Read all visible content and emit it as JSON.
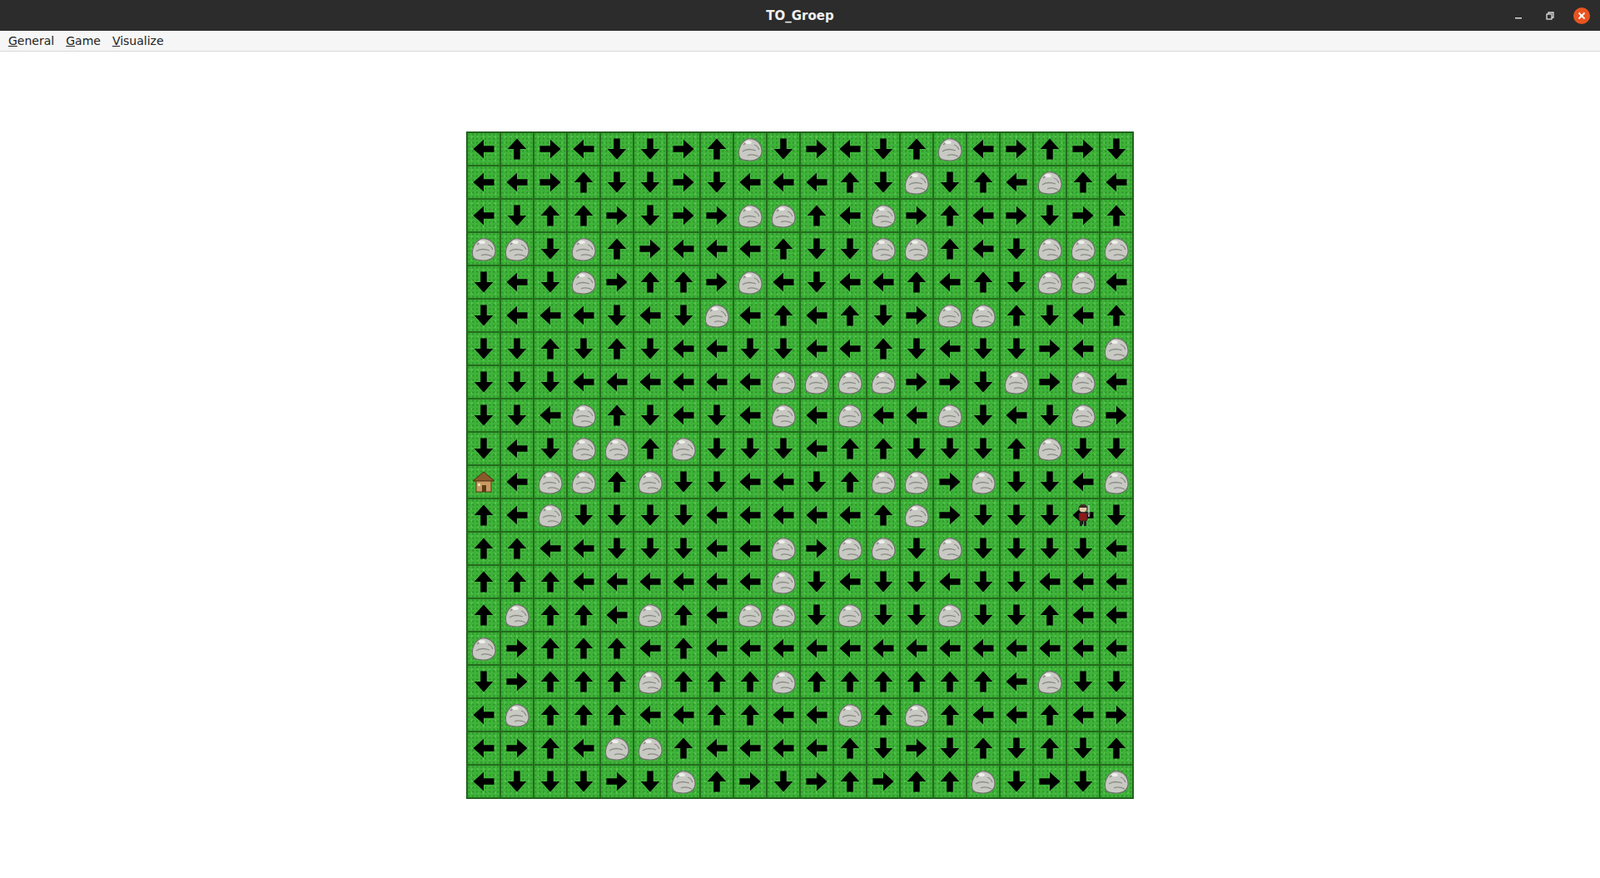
{
  "window": {
    "title": "TO_Groep"
  },
  "menu": [
    {
      "label": "General"
    },
    {
      "label": "Game"
    },
    {
      "label": "Visualize"
    }
  ],
  "player": {
    "row": 11,
    "col": 18
  },
  "grid": [
    [
      "left",
      "up",
      "right",
      "left",
      "down",
      "down",
      "right",
      "up",
      "rock",
      "down",
      "right",
      "left",
      "down",
      "up",
      "rock",
      "left",
      "right",
      "up",
      "right",
      "down"
    ],
    [
      "left",
      "left",
      "right",
      "up",
      "down",
      "down",
      "right",
      "down",
      "left",
      "left",
      "left",
      "up",
      "down",
      "rock",
      "down",
      "up",
      "left",
      "rock",
      "up",
      "left"
    ],
    [
      "left",
      "down",
      "up",
      "up",
      "right",
      "down",
      "right",
      "right",
      "rock",
      "rock",
      "up",
      "left",
      "rock",
      "right",
      "up",
      "left",
      "right",
      "down",
      "right",
      "up"
    ],
    [
      "rock",
      "rock",
      "down",
      "rock",
      "up",
      "right",
      "left",
      "left",
      "left",
      "up",
      "down",
      "down",
      "rock",
      "rock",
      "up",
      "left",
      "down",
      "rock",
      "rock",
      "rock"
    ],
    [
      "down",
      "left",
      "down",
      "rock",
      "right",
      "up",
      "up",
      "right",
      "rock",
      "left",
      "down",
      "left",
      "left",
      "up",
      "left",
      "up",
      "down",
      "rock",
      "rock",
      "left"
    ],
    [
      "down",
      "left",
      "left",
      "left",
      "down",
      "left",
      "down",
      "rock",
      "left",
      "up",
      "left",
      "up",
      "down",
      "right",
      "rock",
      "rock",
      "up",
      "down",
      "left",
      "up"
    ],
    [
      "down",
      "down",
      "up",
      "down",
      "up",
      "down",
      "left",
      "left",
      "down",
      "down",
      "left",
      "left",
      "up",
      "down",
      "left",
      "down",
      "down",
      "right",
      "left",
      "rock"
    ],
    [
      "down",
      "down",
      "down",
      "left",
      "left",
      "left",
      "left",
      "left",
      "left",
      "rock",
      "rock",
      "rock",
      "rock",
      "right",
      "right",
      "down",
      "rock",
      "right",
      "rock",
      "left"
    ],
    [
      "down",
      "down",
      "left",
      "rock",
      "up",
      "down",
      "left",
      "down",
      "left",
      "rock",
      "left",
      "rock",
      "left",
      "left",
      "rock",
      "down",
      "left",
      "down",
      "rock",
      "right"
    ],
    [
      "down",
      "left",
      "down",
      "rock",
      "rock",
      "up",
      "rock",
      "down",
      "down",
      "down",
      "left",
      "up",
      "up",
      "down",
      "down",
      "down",
      "up",
      "rock",
      "down",
      "down"
    ],
    [
      "house",
      "left",
      "rock",
      "rock",
      "up",
      "rock",
      "down",
      "down",
      "left",
      "left",
      "down",
      "up",
      "rock",
      "rock",
      "right",
      "rock",
      "down",
      "down",
      "left",
      "rock"
    ],
    [
      "up",
      "left",
      "rock",
      "down",
      "down",
      "down",
      "down",
      "left",
      "left",
      "left",
      "left",
      "left",
      "up",
      "rock",
      "right",
      "down",
      "down",
      "down",
      "left",
      "down"
    ],
    [
      "up",
      "up",
      "left",
      "left",
      "down",
      "down",
      "down",
      "left",
      "left",
      "rock",
      "right",
      "rock",
      "rock",
      "down",
      "rock",
      "down",
      "down",
      "down",
      "down",
      "left"
    ],
    [
      "up",
      "up",
      "up",
      "left",
      "left",
      "left",
      "left",
      "left",
      "left",
      "rock",
      "down",
      "left",
      "down",
      "down",
      "left",
      "down",
      "down",
      "left",
      "left",
      "left"
    ],
    [
      "up",
      "rock",
      "up",
      "up",
      "left",
      "rock",
      "up",
      "left",
      "rock",
      "rock",
      "down",
      "rock",
      "down",
      "down",
      "rock",
      "down",
      "down",
      "up",
      "left",
      "left"
    ],
    [
      "rock",
      "right",
      "up",
      "up",
      "up",
      "left",
      "up",
      "left",
      "left",
      "left",
      "left",
      "left",
      "left",
      "left",
      "left",
      "left",
      "left",
      "left",
      "left",
      "left"
    ],
    [
      "down",
      "right",
      "up",
      "up",
      "up",
      "rock",
      "up",
      "up",
      "up",
      "rock",
      "up",
      "up",
      "up",
      "up",
      "up",
      "up",
      "left",
      "rock",
      "down",
      "down"
    ],
    [
      "left",
      "rock",
      "up",
      "up",
      "up",
      "left",
      "left",
      "up",
      "up",
      "left",
      "left",
      "rock",
      "up",
      "rock",
      "up",
      "left",
      "left",
      "up",
      "left",
      "right"
    ],
    [
      "left",
      "right",
      "up",
      "left",
      "rock",
      "rock",
      "up",
      "left",
      "left",
      "left",
      "left",
      "up",
      "down",
      "right",
      "down",
      "up",
      "down",
      "up",
      "down",
      "up"
    ],
    [
      "left",
      "down",
      "down",
      "down",
      "right",
      "down",
      "rock",
      "up",
      "right",
      "down",
      "right",
      "up",
      "right",
      "up",
      "up",
      "rock",
      "down",
      "right",
      "down",
      "rock"
    ]
  ]
}
